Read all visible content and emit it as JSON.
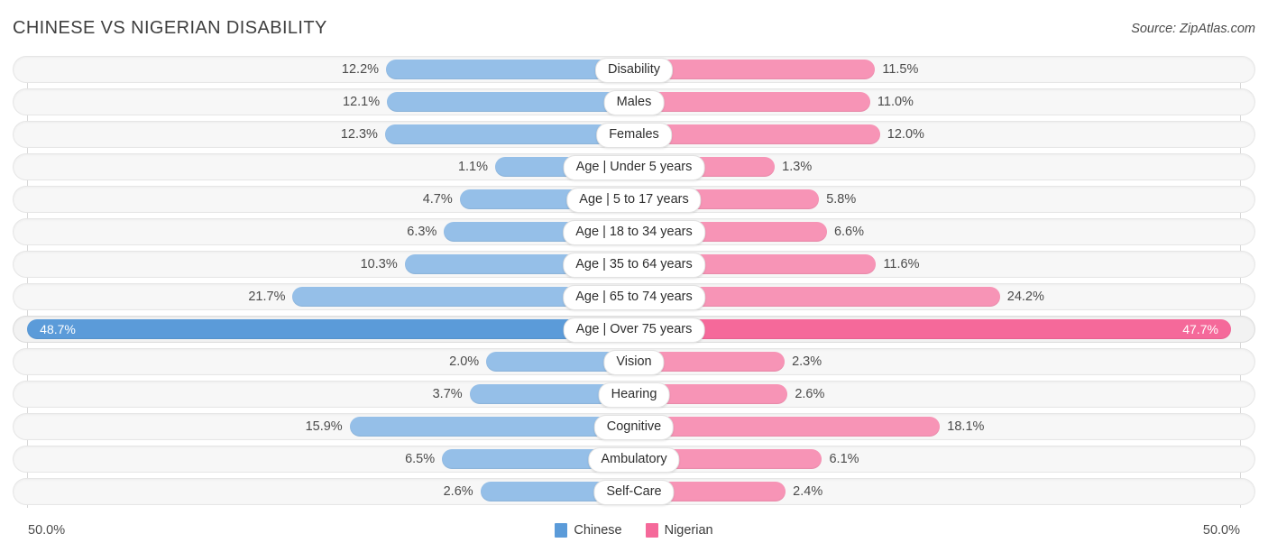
{
  "header": {
    "title": "CHINESE VS NIGERIAN DISABILITY",
    "source": "Source: ZipAtlas.com"
  },
  "legend": {
    "items": [
      {
        "label": "Chinese",
        "color": "#5b9bd9",
        "icon": "legend-swatch"
      },
      {
        "label": "Nigerian",
        "color": "#f5699a",
        "icon": "legend-swatch"
      }
    ]
  },
  "axis": {
    "left_label": "50.0%",
    "right_label": "50.0%",
    "max": 50.0
  },
  "colors": {
    "left_bar": "#95bfe8",
    "right_bar": "#f794b6",
    "left_bar_highlight": "#5b9bd9",
    "right_bar_highlight": "#f5699a",
    "track": "#f7f7f7",
    "gridline": "#d8d8d8"
  },
  "chart_data": {
    "type": "bar",
    "title": "CHINESE VS NIGERIAN DISABILITY",
    "xlabel": "",
    "ylabel": "",
    "orientation": "horizontal-diverging",
    "xlim": [
      50.0,
      50.0
    ],
    "grid": true,
    "legend_position": "bottom-center",
    "categories": [
      "Disability",
      "Males",
      "Females",
      "Age | Under 5 years",
      "Age | 5 to 17 years",
      "Age | 18 to 34 years",
      "Age | 35 to 64 years",
      "Age | 65 to 74 years",
      "Age | Over 75 years",
      "Vision",
      "Hearing",
      "Cognitive",
      "Ambulatory",
      "Self-Care"
    ],
    "series": [
      {
        "name": "Chinese",
        "color": "#95bfe8",
        "values": [
          12.2,
          12.1,
          12.3,
          1.1,
          4.7,
          6.3,
          10.3,
          21.7,
          48.7,
          2.0,
          3.7,
          15.9,
          6.5,
          2.6
        ]
      },
      {
        "name": "Nigerian",
        "color": "#f794b6",
        "values": [
          11.5,
          11.0,
          12.0,
          1.3,
          5.8,
          6.6,
          11.6,
          24.2,
          47.7,
          2.3,
          2.6,
          18.1,
          6.1,
          2.4
        ]
      }
    ]
  },
  "rows": [
    {
      "label": "Disability",
      "left": "12.2%",
      "right": "11.5%",
      "left_val": 12.2,
      "right_val": 11.5,
      "highlight": false
    },
    {
      "label": "Males",
      "left": "12.1%",
      "right": "11.0%",
      "left_val": 12.1,
      "right_val": 11.0,
      "highlight": false
    },
    {
      "label": "Females",
      "left": "12.3%",
      "right": "12.0%",
      "left_val": 12.3,
      "right_val": 12.0,
      "highlight": false
    },
    {
      "label": "Age | Under 5 years",
      "left": "1.1%",
      "right": "1.3%",
      "left_val": 1.1,
      "right_val": 1.3,
      "highlight": false
    },
    {
      "label": "Age | 5 to 17 years",
      "left": "4.7%",
      "right": "5.8%",
      "left_val": 4.7,
      "right_val": 5.8,
      "highlight": false
    },
    {
      "label": "Age | 18 to 34 years",
      "left": "6.3%",
      "right": "6.6%",
      "left_val": 6.3,
      "right_val": 6.6,
      "highlight": false
    },
    {
      "label": "Age | 35 to 64 years",
      "left": "10.3%",
      "right": "11.6%",
      "left_val": 10.3,
      "right_val": 11.6,
      "highlight": false
    },
    {
      "label": "Age | 65 to 74 years",
      "left": "21.7%",
      "right": "24.2%",
      "left_val": 21.7,
      "right_val": 24.2,
      "highlight": false
    },
    {
      "label": "Age | Over 75 years",
      "left": "48.7%",
      "right": "47.7%",
      "left_val": 48.7,
      "right_val": 47.7,
      "highlight": true
    },
    {
      "label": "Vision",
      "left": "2.0%",
      "right": "2.3%",
      "left_val": 2.0,
      "right_val": 2.3,
      "highlight": false
    },
    {
      "label": "Hearing",
      "left": "3.7%",
      "right": "2.6%",
      "left_val": 3.7,
      "right_val": 2.6,
      "highlight": false
    },
    {
      "label": "Cognitive",
      "left": "15.9%",
      "right": "18.1%",
      "left_val": 15.9,
      "right_val": 18.1,
      "highlight": false
    },
    {
      "label": "Ambulatory",
      "left": "6.5%",
      "right": "6.1%",
      "left_val": 6.5,
      "right_val": 6.1,
      "highlight": false
    },
    {
      "label": "Self-Care",
      "left": "2.6%",
      "right": "2.4%",
      "left_val": 2.6,
      "right_val": 2.4,
      "highlight": false
    }
  ]
}
